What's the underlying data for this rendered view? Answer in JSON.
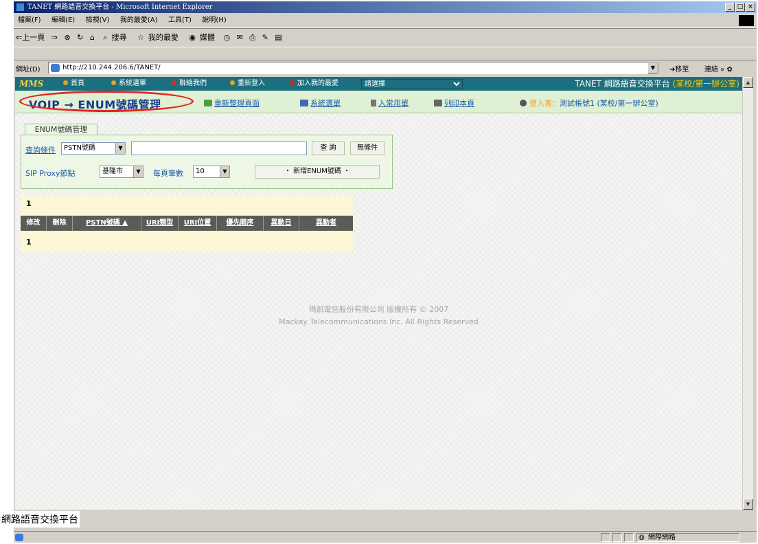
{
  "window": {
    "title": "TANET 網路語音交換平台 - Microsoft Internet Explorer"
  },
  "menu": [
    "檔案(F)",
    "編輯(E)",
    "檢視(V)",
    "我的最愛(A)",
    "工具(T)",
    "說明(H)"
  ],
  "toolbar": {
    "back": "⇐上一頁",
    "search": "搜尋",
    "favorites": "我的最愛",
    "media": "媒體"
  },
  "address": {
    "label": "網址(D)",
    "url": "http://210.244.206.6/TANET/",
    "go": "移至",
    "links": "連結"
  },
  "sitenav": {
    "logo": "MMS",
    "home": "首頁",
    "sysmenu": "系統選單",
    "contact": "聯絡我們",
    "relogin": "重新登入",
    "addfav": "加入我的最愛",
    "select_placeholder": "請選擇",
    "brand": "TANET 網路語音交換平台",
    "brand_org": "(某校/第一辦公室)"
  },
  "breadcrumb": {
    "title": "VOIP → ENUM號碼管理",
    "refresh": "重新整理頁面",
    "sysmenu": "系統選單",
    "favlist": "入常用單",
    "print": "列印本頁",
    "login_label": "登入者：",
    "login_user": "測試帳號1 (某校/第一辦公室)"
  },
  "panel": {
    "tab": "ENUM號碼管理",
    "query_label": "查詢條件",
    "query_field": "PSTN號碼",
    "search_btn": "查 詢",
    "nocond_btn": "無條件",
    "proxy_label": "SIP Proxy節點",
    "proxy_value": "基隆市",
    "perpage_label": "每頁筆數",
    "perpage_value": "10",
    "add_btn": "・ 新增ENUM號碼 ・"
  },
  "results": {
    "page_top": "1",
    "page_bottom": "1",
    "columns": [
      "修改",
      "刪除",
      "PSTN號碼 ▲",
      "URI類型",
      "URI位置",
      "優先順序",
      "異動日",
      "異動者"
    ]
  },
  "footer": {
    "line1": "瑪凱電信股份有限公司 版權所有 © 2007",
    "line2": "Mackay Telecommunications Inc. All Rights Reserved"
  },
  "statusbar": {
    "zone": "網際網路"
  },
  "caption": "網路語音交換平台"
}
